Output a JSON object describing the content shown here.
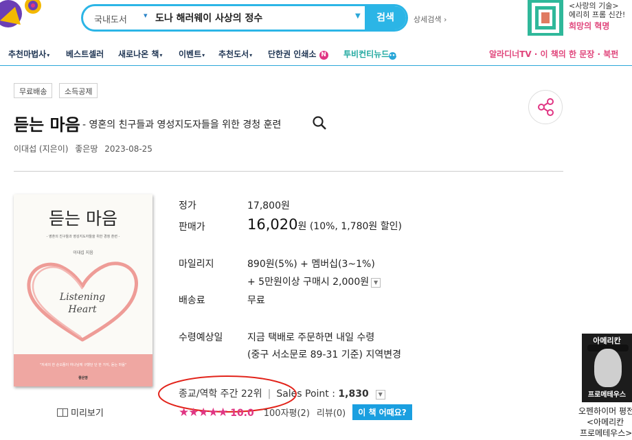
{
  "header": {
    "search": {
      "category": "국내도서",
      "query": "도나 해러웨이 사상의 정수",
      "button": "검색"
    },
    "advanced_search": "상세검색 ›",
    "ad": {
      "line1": "<사랑의 기술>",
      "line2": "에리히 프롬 신간!",
      "line3": "희망의 혁명"
    }
  },
  "nav": {
    "items": [
      {
        "label": "추천마법사",
        "caret": "▾"
      },
      {
        "label": "베스트셀러",
        "caret": ""
      },
      {
        "label": "새로나온 책",
        "caret": "▾"
      },
      {
        "label": "이벤트",
        "caret": "▾"
      },
      {
        "label": "추천도서",
        "caret": "▾"
      },
      {
        "label": "단한권 인쇄소",
        "caret": ""
      },
      {
        "label": "투비컨티뉴드",
        "caret": ""
      }
    ],
    "new_badge": "N",
    "dots_badge": "•••",
    "right": "알라디너TV · 이 책의 한 문장 · 북펀"
  },
  "tags": [
    "무료배송",
    "소득공제"
  ],
  "book": {
    "title": "듣는 마음",
    "subtitle": "- 영혼의 친구들과 영성지도자들을 위한 경청 훈련",
    "author": "이대섭 (지은이)",
    "publisher": "좋은땅",
    "date": "2023-08-25",
    "cover": {
      "title": "듣는 마음",
      "subtitle": "- 영혼의 친구들과 영성지도자들을 위한 경청 훈련 -",
      "author": "이대섭 지음",
      "heart_text_1": "Listening",
      "heart_text_2": "Heart",
      "band_text": "\"저세의 한 순오쯤이 하나님께 구했던 단 한 가지, 듣는 마음\"",
      "publisher_mark": "좋은땅"
    },
    "preview": "미리보기"
  },
  "pricing": {
    "list_price_label": "정가",
    "list_price": "17,800원",
    "sale_label": "판매가",
    "sale_price": "16,020",
    "sale_unit": "원",
    "sale_discount": "(10%, 1,780원 할인)",
    "mileage_label": "마일리지",
    "mileage_line1": "890원(5%) + 멤버십(3~1%)",
    "mileage_line2": "+ 5만원이상 구매시 2,000원",
    "shipping_label": "배송료",
    "shipping": "무료",
    "receive_label": "수령예상일",
    "receive_line1": "지금 택배로 주문하면 내일 수령",
    "receive_line2": "(중구 서소문로 89-31 기준) 지역변경"
  },
  "ranking": {
    "rank": "종교/역학 주간 22위",
    "sep": "|",
    "sales_point_label": "Sales Point :",
    "sales_point": "1,830"
  },
  "rating": {
    "stars": "★★★★★",
    "score": "10.0",
    "reviews_a": "100자평(2)",
    "reviews_b": "리뷰(0)",
    "ask_button": "이 책 어때요?"
  },
  "side_ad": {
    "top": "아메리칸",
    "bottom": "프로메테우스",
    "line1": "오펜하이머 평전",
    "line2": "<아메리칸",
    "line3": "프로메테우스>"
  },
  "colors": {
    "accent_blue": "#2bb5e6",
    "accent_pink": "#e03583",
    "nav_text": "#1f3553"
  }
}
